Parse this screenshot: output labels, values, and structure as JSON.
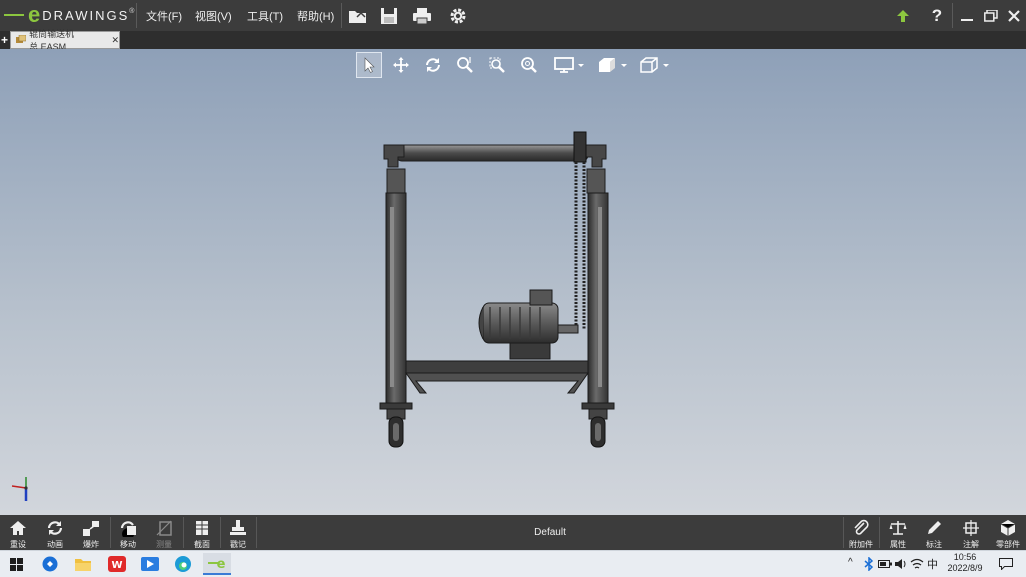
{
  "app": {
    "logo_letter": "e",
    "logo_text": "DRAWINGS",
    "logo_mark": "®"
  },
  "menu": {
    "file": "文件(F)",
    "view": "视图(V)",
    "tools": "工具(T)",
    "help": "帮助(H)"
  },
  "tab": {
    "title": "辊筒输送机总.EASM",
    "close": "✕",
    "add": "+"
  },
  "viewport": {
    "display_state": "Default"
  },
  "bottom_left": [
    {
      "label": "重设"
    },
    {
      "label": "动画"
    },
    {
      "label": "爆炸"
    },
    {
      "label": "移动"
    },
    {
      "label": "测量"
    },
    {
      "label": "截面"
    },
    {
      "label": "戳记"
    }
  ],
  "bottom_right": [
    {
      "label": "附加件"
    },
    {
      "label": "属性"
    },
    {
      "label": "标注"
    },
    {
      "label": "注解"
    },
    {
      "label": "零部件"
    }
  ],
  "taskbar": {
    "time": "10:56",
    "date": "2022/8/9",
    "ime": "中"
  },
  "colors": {
    "menubar": "#3c3c3c",
    "brand": "#8cc63f",
    "upgrade": "#8cc63f",
    "viewport_top": "#8ea0b8"
  }
}
